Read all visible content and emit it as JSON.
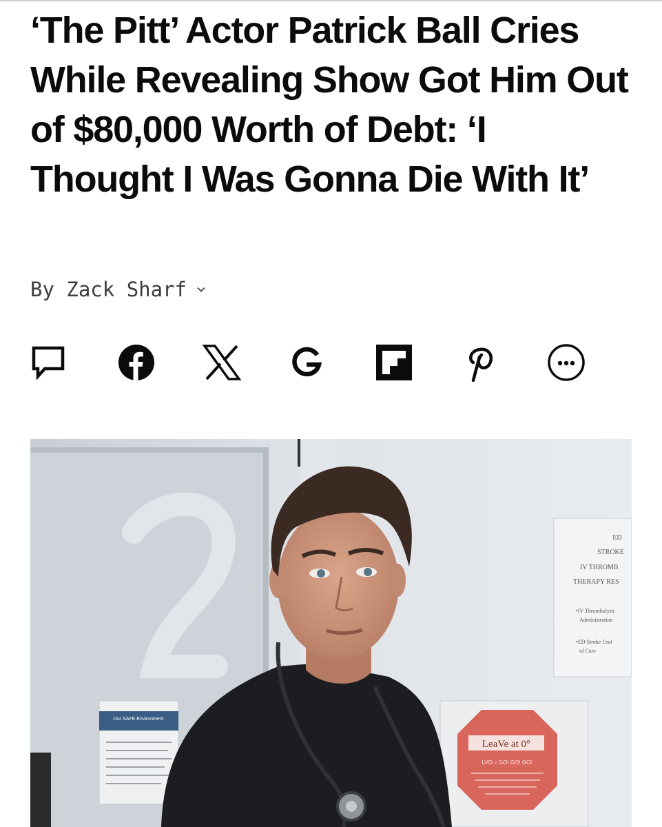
{
  "article": {
    "headline": "‘The Pitt’ Actor Patrick Ball Cries While Revealing Show Got Him Out of $80,000 Worth of Debt: ‘I Thought I Was Gonna Die With It’",
    "byline_prefix": "By",
    "author": "Zack Sharf"
  },
  "share_bar": {
    "icons": [
      "comment-icon",
      "facebook-icon",
      "x-icon",
      "google-icon",
      "flipboard-icon",
      "pinterest-icon",
      "more-icon"
    ]
  },
  "photo": {
    "sign_lines": [
      "ED",
      "STROKE",
      "IV THROMB",
      "THERAPY RES",
      "•IV Thrombolytic",
      "Administration",
      "•ED Stroke Unit",
      "of Care"
    ],
    "poster_title": "Our SAFE Environment",
    "stop_sign_text": "LeaVe at 0°",
    "stop_sign_sub": "LVO = GO! GO! GO!"
  },
  "colors": {
    "text": "#0b0b0b",
    "byline": "#3c3c3c"
  }
}
